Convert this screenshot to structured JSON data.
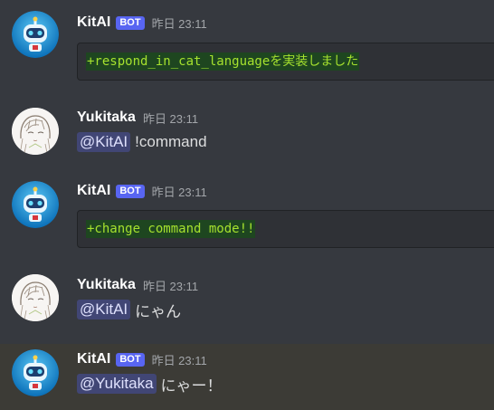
{
  "messages": [
    {
      "author": "KitAI",
      "bot_tag": "BOT",
      "timestamp": "昨日 23:11",
      "code_line": "+respond_in_cat_languageを実装しました"
    },
    {
      "author": "Yukitaka",
      "timestamp": "昨日 23:11",
      "mention": "@KitAI",
      "text": "!command"
    },
    {
      "author": "KitAI",
      "bot_tag": "BOT",
      "timestamp": "昨日 23:11",
      "code_line": "+change command mode!!"
    },
    {
      "author": "Yukitaka",
      "timestamp": "昨日 23:11",
      "mention": "@KitAI",
      "text": "にゃん"
    },
    {
      "author": "KitAI",
      "bot_tag": "BOT",
      "timestamp": "昨日 23:11",
      "mention": "@Yukitaka",
      "text": "にゃー！",
      "highlighted": true
    }
  ],
  "colors": {
    "background": "#36393f",
    "highlight": "#3c3b36",
    "bot_tag": "#5865f2",
    "mention_bg": "#414675",
    "diff_added_bg": "#1e4620",
    "diff_added_text": "#a6e22e"
  }
}
